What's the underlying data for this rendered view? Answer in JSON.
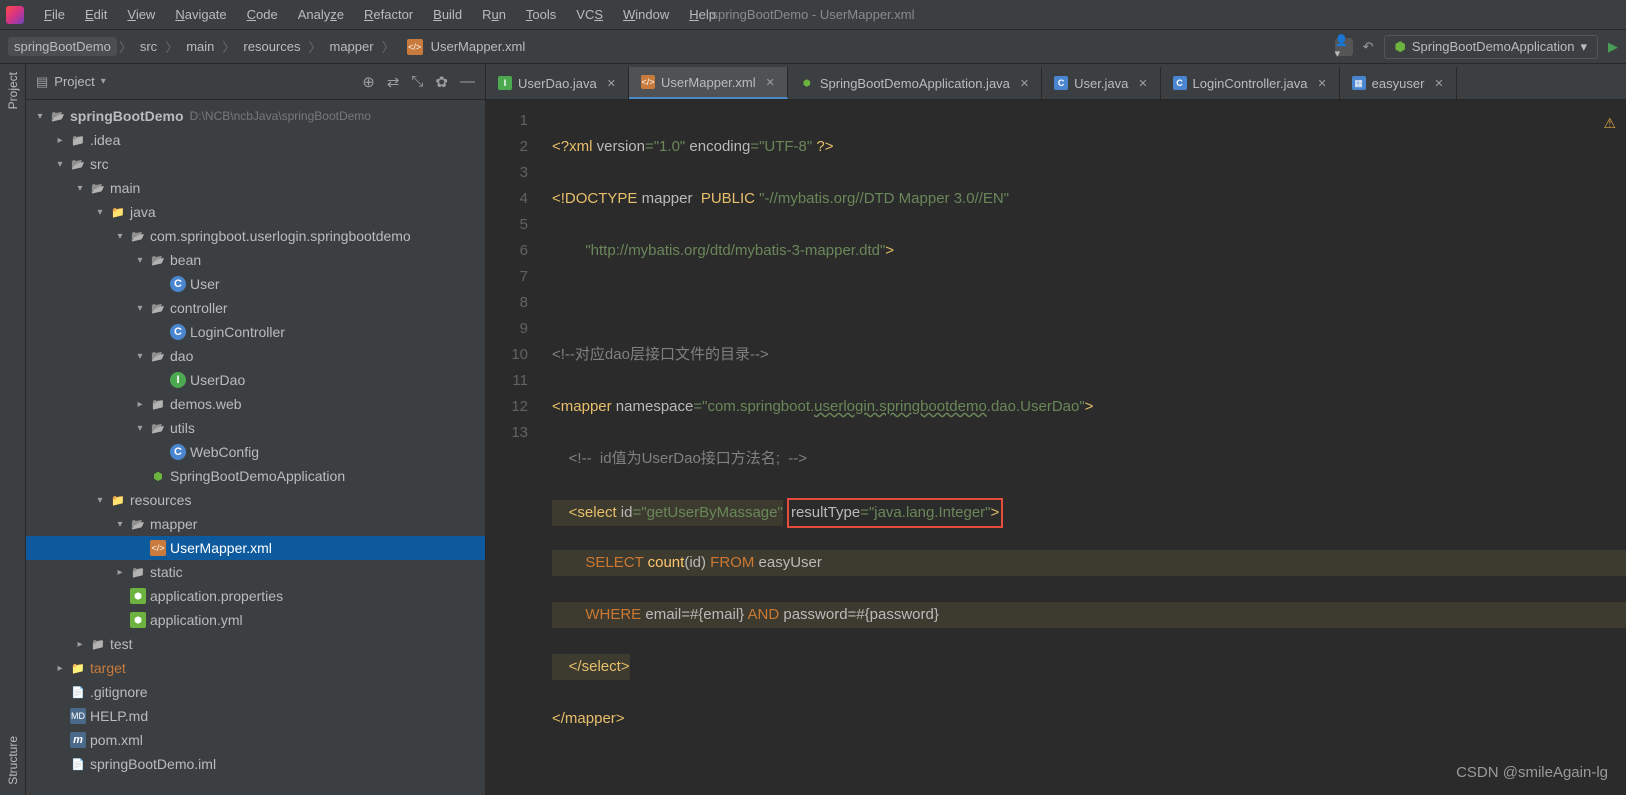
{
  "window_title": "springBootDemo - UserMapper.xml",
  "menus": [
    "File",
    "Edit",
    "View",
    "Navigate",
    "Code",
    "Analyze",
    "Refactor",
    "Build",
    "Run",
    "Tools",
    "VCS",
    "Window",
    "Help"
  ],
  "breadcrumbs": [
    "springBootDemo",
    "src",
    "main",
    "resources",
    "mapper",
    "UserMapper.xml"
  ],
  "run_config": "SpringBootDemoApplication",
  "panel": {
    "title": "Project"
  },
  "side_tabs": [
    "Project",
    "Structure"
  ],
  "tree": {
    "root": "springBootDemo",
    "root_path": "D:\\NCB\\ncbJava\\springBootDemo",
    "idea": ".idea",
    "src": "src",
    "main": "main",
    "java": "java",
    "pkg": "com.springboot.userlogin.springbootdemo",
    "bean": "bean",
    "user": "User",
    "controller": "controller",
    "loginctrl": "LoginController",
    "dao": "dao",
    "userdao": "UserDao",
    "demos": "demos.web",
    "utils": "utils",
    "webconfig": "WebConfig",
    "app": "SpringBootDemoApplication",
    "resources": "resources",
    "mapper": "mapper",
    "usermapper": "UserMapper.xml",
    "static": "static",
    "appprops": "application.properties",
    "appyml": "application.yml",
    "test": "test",
    "target": "target",
    "gitignore": ".gitignore",
    "help": "HELP.md",
    "pom": "pom.xml",
    "iml": "springBootDemo.iml"
  },
  "tabs": [
    {
      "label": "UserDao.java",
      "icon": "I",
      "active": false
    },
    {
      "label": "UserMapper.xml",
      "icon": "X",
      "active": true
    },
    {
      "label": "SpringBootDemoApplication.java",
      "icon": "S",
      "active": false
    },
    {
      "label": "User.java",
      "icon": "C",
      "active": false
    },
    {
      "label": "LoginController.java",
      "icon": "C",
      "active": false
    },
    {
      "label": "easyuser",
      "icon": "T",
      "active": false
    }
  ],
  "code": {
    "l1_a": "<?xml ",
    "l1_b": "version",
    "l1_c": "=",
    "l1_d": "\"1.0\"",
    "l1_e": " encoding",
    "l1_f": "=",
    "l1_g": "\"UTF-8\"",
    "l1_h": " ?>",
    "l2_a": "<!DOCTYPE ",
    "l2_b": "mapper  ",
    "l2_c": "PUBLIC ",
    "l2_d": "\"-//mybatis.org//DTD Mapper 3.0//EN\"",
    "l3_a": "        ",
    "l3_b": "\"http://mybatis.org/dtd/mybatis-3-mapper.dtd\"",
    "l3_c": ">",
    "l5": "<!--对应dao层接口文件的目录-->",
    "l6_a": "<mapper ",
    "l6_b": "namespace",
    "l6_c": "=",
    "l6_d": "\"com.springboot.",
    "l6_e": "userlogin.springbootdemo",
    "l6_f": ".dao.UserDao\"",
    "l6_g": ">",
    "l7": "    <!--  id值为UserDao接口方法名;  -->",
    "l8_a": "    <select ",
    "l8_b": "id",
    "l8_c": "=",
    "l8_d": "\"getUserByMassage\"",
    "l8_e": " ",
    "l8_f": "resultType",
    "l8_g": "=",
    "l8_h": "\"java.lang.Integer\"",
    "l8_i": ">",
    "l9_a": "        ",
    "l9_b": "SELECT",
    "l9_c": " count",
    "l9_d": "(",
    "l9_e": "id",
    "l9_f": ") ",
    "l9_g": "FROM",
    "l9_h": " easyUser",
    "l10_a": "        ",
    "l10_b": "WHERE",
    "l10_c": " email=#{email} ",
    "l10_d": "AND",
    "l10_e": " password=#{password}",
    "l11": "    </select>",
    "l12": "</mapper>"
  },
  "line_numbers": [
    "1",
    "2",
    "3",
    "4",
    "5",
    "6",
    "7",
    "8",
    "9",
    "10",
    "11",
    "12",
    "13"
  ],
  "watermark": "CSDN @smileAgain-lg"
}
